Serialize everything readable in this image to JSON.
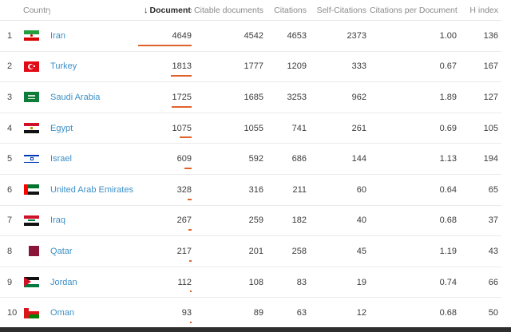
{
  "header": {
    "country": "Country",
    "documents": "Documents",
    "sort_arrow": "↓",
    "citable": "Citable documents",
    "citations": "Citations",
    "self_citations": "Self-Citations",
    "cpd": "Citations per Document",
    "hindex": "H index"
  },
  "accent_color": "#e0622b",
  "link_color": "#3d8fc7",
  "max_documents": 4649,
  "rows": [
    {
      "rank": "1",
      "flag": "iran-flag",
      "country": "Iran",
      "documents": "4649",
      "citable": "4542",
      "citations": "4653",
      "self": "2373",
      "cpd": "1.00",
      "h": "136"
    },
    {
      "rank": "2",
      "flag": "turkey-flag",
      "country": "Turkey",
      "documents": "1813",
      "citable": "1777",
      "citations": "1209",
      "self": "333",
      "cpd": "0.67",
      "h": "167"
    },
    {
      "rank": "3",
      "flag": "saudi-arabia-flag",
      "country": "Saudi Arabia",
      "documents": "1725",
      "citable": "1685",
      "citations": "3253",
      "self": "962",
      "cpd": "1.89",
      "h": "127"
    },
    {
      "rank": "4",
      "flag": "egypt-flag",
      "country": "Egypt",
      "documents": "1075",
      "citable": "1055",
      "citations": "741",
      "self": "261",
      "cpd": "0.69",
      "h": "105"
    },
    {
      "rank": "5",
      "flag": "israel-flag",
      "country": "Israel",
      "documents": "609",
      "citable": "592",
      "citations": "686",
      "self": "144",
      "cpd": "1.13",
      "h": "194"
    },
    {
      "rank": "6",
      "flag": "uae-flag",
      "country": "United Arab Emirates",
      "documents": "328",
      "citable": "316",
      "citations": "211",
      "self": "60",
      "cpd": "0.64",
      "h": "65"
    },
    {
      "rank": "7",
      "flag": "iraq-flag",
      "country": "Iraq",
      "documents": "267",
      "citable": "259",
      "citations": "182",
      "self": "40",
      "cpd": "0.68",
      "h": "37"
    },
    {
      "rank": "8",
      "flag": "qatar-flag",
      "country": "Qatar",
      "documents": "217",
      "citable": "201",
      "citations": "258",
      "self": "45",
      "cpd": "1.19",
      "h": "43"
    },
    {
      "rank": "9",
      "flag": "jordan-flag",
      "country": "Jordan",
      "documents": "112",
      "citable": "108",
      "citations": "83",
      "self": "19",
      "cpd": "0.74",
      "h": "66"
    },
    {
      "rank": "10",
      "flag": "oman-flag",
      "country": "Oman",
      "documents": "93",
      "citable": "89",
      "citations": "63",
      "self": "12",
      "cpd": "0.68",
      "h": "50"
    }
  ]
}
